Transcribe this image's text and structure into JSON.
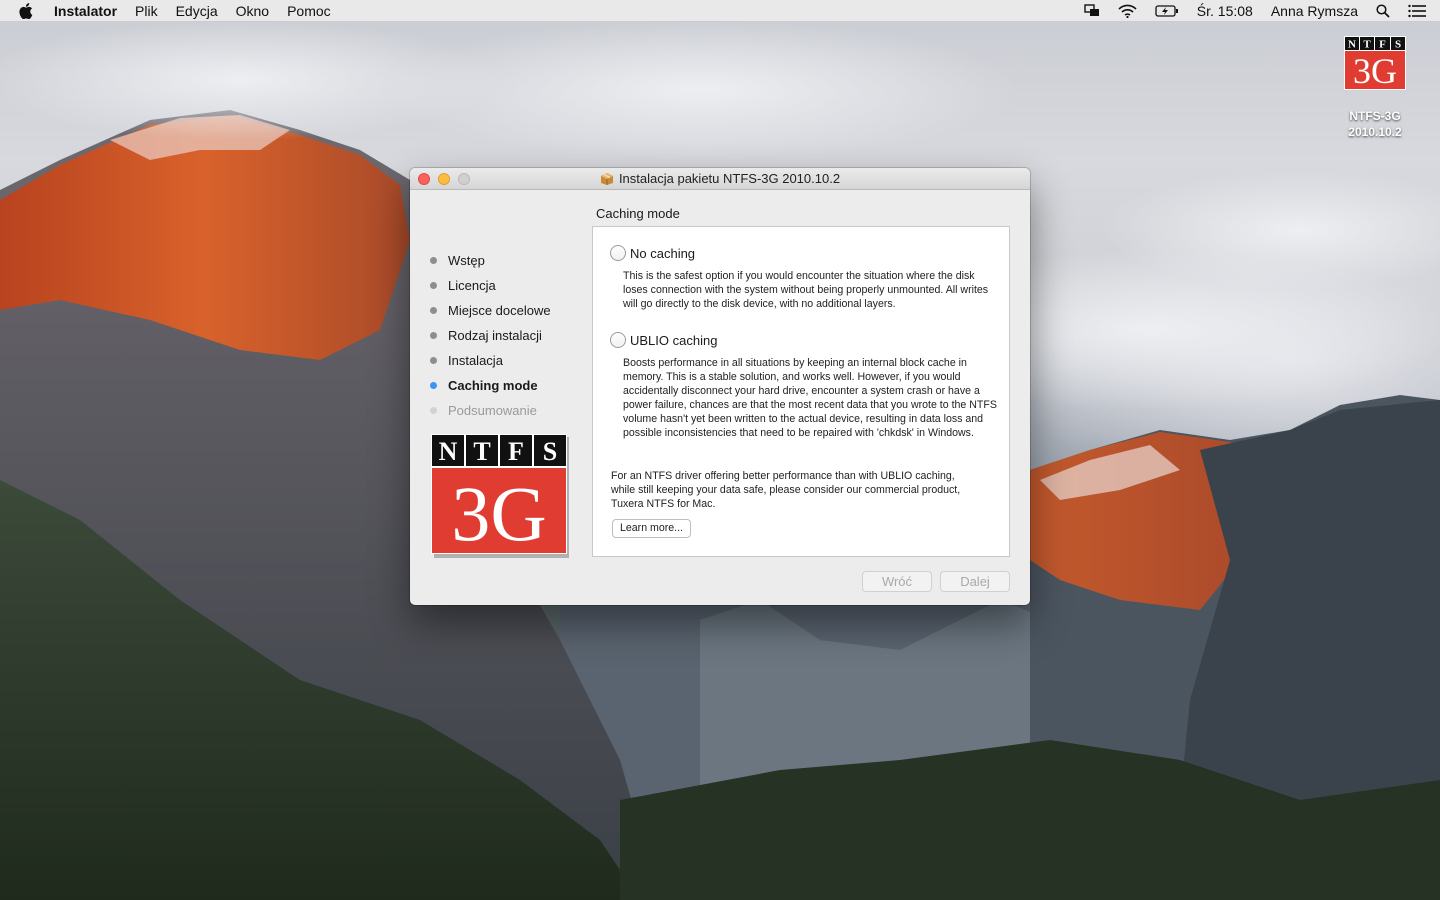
{
  "menubar": {
    "app_name": "Instalator",
    "menus": [
      "Plik",
      "Edycja",
      "Okno",
      "Pomoc"
    ],
    "clock": "Śr. 15:08",
    "user": "Anna Rymsza",
    "status_icons": [
      "display-mirror-icon",
      "wifi-icon",
      "battery-icon",
      "search-icon",
      "list-icon"
    ]
  },
  "desktop_icon": {
    "logo_top": [
      "N",
      "T",
      "F",
      "S"
    ],
    "logo_bottom": "3G",
    "label_line1": "NTFS-3G",
    "label_line2": "2010.10.2"
  },
  "window": {
    "title": "Instalacja pakietu NTFS-3G 2010.10.2",
    "steps": [
      {
        "label": "Wstęp",
        "state": "done"
      },
      {
        "label": "Licencja",
        "state": "done"
      },
      {
        "label": "Miejsce docelowe",
        "state": "done"
      },
      {
        "label": "Rodzaj instalacji",
        "state": "done"
      },
      {
        "label": "Instalacja",
        "state": "done"
      },
      {
        "label": "Caching mode",
        "state": "active"
      },
      {
        "label": "Podsumowanie",
        "state": "future"
      }
    ],
    "logo_top": [
      "N",
      "T",
      "F",
      "S"
    ],
    "logo_bottom": "3G",
    "section_title": "Caching mode",
    "options": [
      {
        "label": "No caching",
        "selected": false,
        "description": "This is the safest option if you would encounter the situation where the disk loses connection with the system without being properly unmounted. All writes will go directly to the disk device, with no additional layers."
      },
      {
        "label": "UBLIO caching",
        "selected": false,
        "description": "Boosts performance in all situations by keeping an internal block cache in memory. This is a stable solution, and works well. However, if you would accidentally disconnect your hard drive, encounter a system crash or have a power failure, chances are that the most recent data that you wrote to the NTFS volume hasn't yet been written to the actual device, resulting in data loss and possible inconsistencies that need to be repaired with 'chkdsk' in Windows."
      }
    ],
    "note": "For an NTFS driver offering better performance than with UBLIO caching, while still keeping your data safe, please consider our commercial product, Tuxera NTFS for Mac.",
    "learn_more_label": "Learn more...",
    "back_label": "Wróć",
    "next_label": "Dalej"
  },
  "colors": {
    "active_step_dot": "#3d93f5",
    "logo_red": "#e03c31",
    "logo_black": "#111111"
  }
}
